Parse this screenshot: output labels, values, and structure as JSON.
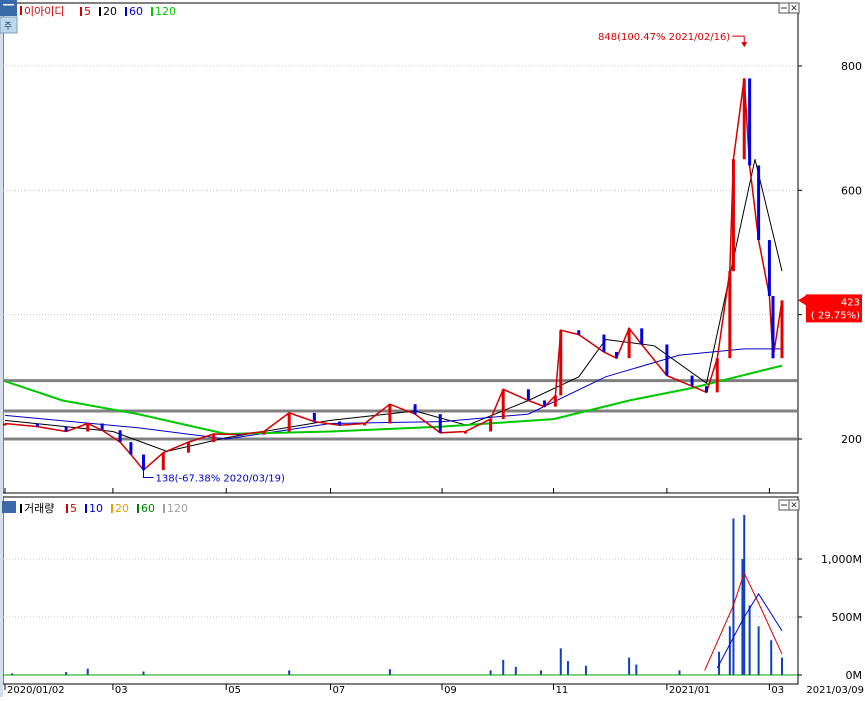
{
  "chart_data": [
    {
      "type": "candlestick",
      "title": "이아이디",
      "ma_legend": [
        {
          "label": "5",
          "color": "#d40000"
        },
        {
          "label": "20",
          "color": "#000000"
        },
        {
          "label": "60",
          "color": "#0000c8"
        },
        {
          "label": "120",
          "color": "#00c800"
        }
      ],
      "y_ticks": [
        "200",
        "400",
        "600",
        "800"
      ],
      "y_tick_values": [
        200,
        400,
        600,
        800
      ],
      "ylim": [
        120,
        880
      ],
      "x_ticks": [
        "2020/01/02",
        "03",
        "05",
        "07",
        "09",
        "11",
        "2021/01",
        "03"
      ],
      "x_tick_dates": [
        "2020-01-02",
        "2020-03-02",
        "2020-05-04",
        "2020-07-01",
        "2020-09-01",
        "2020-11-02",
        "2021-01-04",
        "2021-03-02"
      ],
      "x_range": [
        "2020-01-02",
        "2021-03-09"
      ],
      "end_date_label": "2021/03/09",
      "high_annotation": "848(100.47% 2021/02/16)",
      "low_annotation": "138(-67.38% 2020/03/19)",
      "last_price_label": "423",
      "last_change_label": "( 29.75%)",
      "horizontal_levels": [
        294,
        245,
        200
      ],
      "close_series": [
        {
          "date": "2020-01-02",
          "value": 225
        },
        {
          "date": "2020-01-20",
          "value": 220
        },
        {
          "date": "2020-02-05",
          "value": 212
        },
        {
          "date": "2020-02-17",
          "value": 225
        },
        {
          "date": "2020-02-25",
          "value": 214
        },
        {
          "date": "2020-03-06",
          "value": 195
        },
        {
          "date": "2020-03-12",
          "value": 175
        },
        {
          "date": "2020-03-19",
          "value": 150
        },
        {
          "date": "2020-03-30",
          "value": 178
        },
        {
          "date": "2020-04-13",
          "value": 195
        },
        {
          "date": "2020-04-27",
          "value": 208
        },
        {
          "date": "2020-05-11",
          "value": 207
        },
        {
          "date": "2020-05-25",
          "value": 212
        },
        {
          "date": "2020-06-08",
          "value": 242
        },
        {
          "date": "2020-06-22",
          "value": 228
        },
        {
          "date": "2020-07-06",
          "value": 222
        },
        {
          "date": "2020-07-20",
          "value": 225
        },
        {
          "date": "2020-08-03",
          "value": 256
        },
        {
          "date": "2020-08-17",
          "value": 240
        },
        {
          "date": "2020-08-31",
          "value": 210
        },
        {
          "date": "2020-09-14",
          "value": 212
        },
        {
          "date": "2020-09-28",
          "value": 232
        },
        {
          "date": "2020-10-05",
          "value": 280
        },
        {
          "date": "2020-10-19",
          "value": 262
        },
        {
          "date": "2020-10-28",
          "value": 252
        },
        {
          "date": "2020-11-03",
          "value": 270
        },
        {
          "date": "2020-11-06",
          "value": 375
        },
        {
          "date": "2020-11-16",
          "value": 368
        },
        {
          "date": "2020-11-30",
          "value": 340
        },
        {
          "date": "2020-12-07",
          "value": 330
        },
        {
          "date": "2020-12-14",
          "value": 378
        },
        {
          "date": "2020-12-21",
          "value": 352
        },
        {
          "date": "2021-01-04",
          "value": 302
        },
        {
          "date": "2021-01-18",
          "value": 285
        },
        {
          "date": "2021-01-26",
          "value": 275
        },
        {
          "date": "2021-02-01",
          "value": 330
        },
        {
          "date": "2021-02-08",
          "value": 470
        },
        {
          "date": "2021-02-10",
          "value": 650
        },
        {
          "date": "2021-02-16",
          "value": 780
        },
        {
          "date": "2021-02-19",
          "value": 640
        },
        {
          "date": "2021-02-24",
          "value": 520
        },
        {
          "date": "2021-03-02",
          "value": 430
        },
        {
          "date": "2021-03-04",
          "value": 330
        },
        {
          "date": "2021-03-09",
          "value": 423
        }
      ],
      "ma_series": [
        {
          "name": "20",
          "color": "#000000",
          "points": [
            {
              "date": "2020-01-02",
              "value": 230
            },
            {
              "date": "2020-03-02",
              "value": 212
            },
            {
              "date": "2020-04-01",
              "value": 180
            },
            {
              "date": "2020-05-04",
              "value": 202
            },
            {
              "date": "2020-07-01",
              "value": 230
            },
            {
              "date": "2020-08-17",
              "value": 245
            },
            {
              "date": "2020-09-15",
              "value": 222
            },
            {
              "date": "2020-10-19",
              "value": 262
            },
            {
              "date": "2020-11-16",
              "value": 300
            },
            {
              "date": "2020-12-01",
              "value": 360
            },
            {
              "date": "2020-12-28",
              "value": 350
            },
            {
              "date": "2021-01-26",
              "value": 290
            },
            {
              "date": "2021-02-22",
              "value": 650
            },
            {
              "date": "2021-03-09",
              "value": 470
            }
          ]
        },
        {
          "name": "60",
          "color": "#0000c8",
          "points": [
            {
              "date": "2020-01-02",
              "value": 238
            },
            {
              "date": "2020-03-16",
              "value": 218
            },
            {
              "date": "2020-05-04",
              "value": 200
            },
            {
              "date": "2020-07-01",
              "value": 225
            },
            {
              "date": "2020-09-01",
              "value": 228
            },
            {
              "date": "2020-10-19",
              "value": 240
            },
            {
              "date": "2020-12-01",
              "value": 300
            },
            {
              "date": "2021-01-11",
              "value": 335
            },
            {
              "date": "2021-02-16",
              "value": 345
            },
            {
              "date": "2021-03-09",
              "value": 345
            }
          ]
        },
        {
          "name": "120",
          "color": "#00c800",
          "points": [
            {
              "date": "2020-01-02",
              "value": 293
            },
            {
              "date": "2020-02-03",
              "value": 262
            },
            {
              "date": "2020-03-16",
              "value": 240
            },
            {
              "date": "2020-05-04",
              "value": 208
            },
            {
              "date": "2020-07-01",
              "value": 212
            },
            {
              "date": "2020-09-01",
              "value": 220
            },
            {
              "date": "2020-11-02",
              "value": 232
            },
            {
              "date": "2020-12-14",
              "value": 262
            },
            {
              "date": "2021-01-18",
              "value": 282
            },
            {
              "date": "2021-03-09",
              "value": 318
            }
          ]
        }
      ]
    },
    {
      "type": "bar",
      "title": "거래량",
      "ma_legend": [
        {
          "label": "5",
          "color": "#d40000"
        },
        {
          "label": "10",
          "color": "#0000c8"
        },
        {
          "label": "20",
          "color": "#e0a000"
        },
        {
          "label": "60",
          "color": "#008000"
        },
        {
          "label": "120",
          "color": "#a0a0a0"
        }
      ],
      "y_ticks": [
        "0M",
        "500M",
        "1,000M"
      ],
      "y_tick_values": [
        0,
        500,
        1000
      ],
      "ylim": [
        0,
        1450
      ],
      "ylabel_unit": "M",
      "volume_series": [
        {
          "date": "2020-01-06",
          "value": 15
        },
        {
          "date": "2020-02-05",
          "value": 25
        },
        {
          "date": "2020-02-17",
          "value": 55
        },
        {
          "date": "2020-03-19",
          "value": 30
        },
        {
          "date": "2020-06-08",
          "value": 40
        },
        {
          "date": "2020-08-03",
          "value": 50
        },
        {
          "date": "2020-09-28",
          "value": 40
        },
        {
          "date": "2020-10-05",
          "value": 130
        },
        {
          "date": "2020-10-12",
          "value": 70
        },
        {
          "date": "2020-10-26",
          "value": 40
        },
        {
          "date": "2020-11-06",
          "value": 230
        },
        {
          "date": "2020-11-10",
          "value": 120
        },
        {
          "date": "2020-11-20",
          "value": 80
        },
        {
          "date": "2020-12-14",
          "value": 150
        },
        {
          "date": "2020-12-18",
          "value": 90
        },
        {
          "date": "2021-01-11",
          "value": 40
        },
        {
          "date": "2021-02-02",
          "value": 200
        },
        {
          "date": "2021-02-08",
          "value": 420
        },
        {
          "date": "2021-02-10",
          "value": 1350
        },
        {
          "date": "2021-02-15",
          "value": 1000
        },
        {
          "date": "2021-02-16",
          "value": 1380
        },
        {
          "date": "2021-02-19",
          "value": 600
        },
        {
          "date": "2021-02-24",
          "value": 420
        },
        {
          "date": "2021-03-03",
          "value": 300
        },
        {
          "date": "2021-03-09",
          "value": 150
        }
      ],
      "ma_series": [
        {
          "name": "5",
          "color": "#d40000",
          "points": [
            {
              "date": "2021-01-25",
              "value": 40
            },
            {
              "date": "2021-02-10",
              "value": 600
            },
            {
              "date": "2021-02-16",
              "value": 880
            },
            {
              "date": "2021-02-24",
              "value": 620
            },
            {
              "date": "2021-03-09",
              "value": 180
            }
          ]
        },
        {
          "name": "10",
          "color": "#0000c8",
          "points": [
            {
              "date": "2021-02-01",
              "value": 60
            },
            {
              "date": "2021-02-16",
              "value": 500
            },
            {
              "date": "2021-02-24",
              "value": 700
            },
            {
              "date": "2021-03-09",
              "value": 380
            }
          ]
        }
      ]
    }
  ]
}
